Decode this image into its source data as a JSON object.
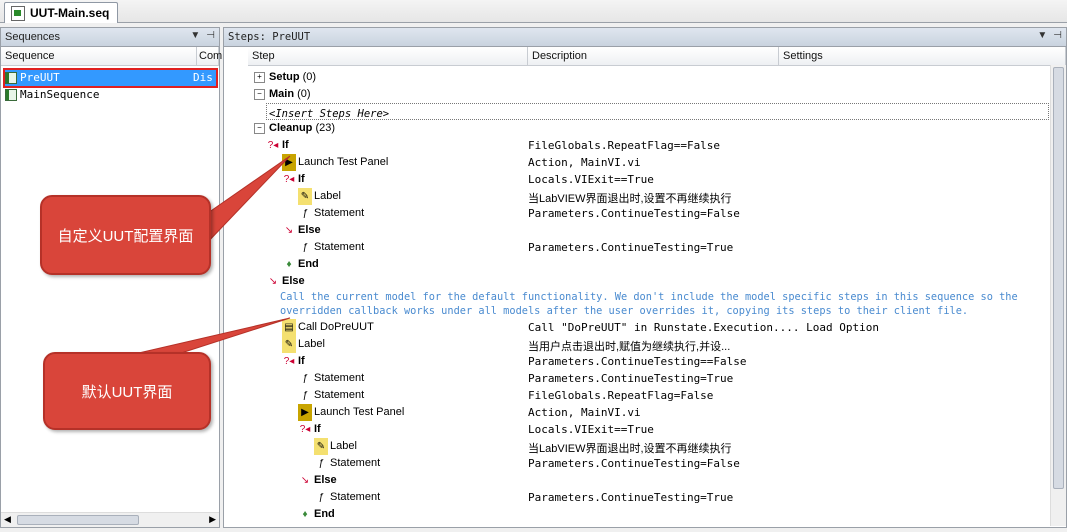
{
  "tab": {
    "title": "UUT-Main.seq"
  },
  "sequences_pane": {
    "title": "Sequences",
    "columns": [
      "Sequence",
      "Com"
    ],
    "rows": [
      {
        "name": "PreUUT",
        "comment": "Dis"
      },
      {
        "name": "MainSequence",
        "comment": ""
      }
    ]
  },
  "steps_pane": {
    "title": "Steps: PreUUT",
    "columns": [
      "Step",
      "Description",
      "Settings"
    ],
    "groups": {
      "setup": {
        "name": "Setup",
        "count": "(0)"
      },
      "main": {
        "name": "Main",
        "count": "(0)",
        "placeholder": "<Insert Steps Here>"
      },
      "cleanup": {
        "name": "Cleanup",
        "count": "(23)"
      }
    },
    "steps": [
      {
        "name": "If",
        "desc": "FileGlobals.RepeatFlag==False"
      },
      {
        "name": "Launch Test Panel",
        "desc": "Action,   MainVI.vi"
      },
      {
        "name": "If",
        "desc": "Locals.VIExit==True"
      },
      {
        "name": "Label",
        "desc": "当LabVIEW界面退出时,设置不再继续执行"
      },
      {
        "name": "Statement",
        "desc": "Parameters.ContinueTesting=False"
      },
      {
        "name": "Else",
        "desc": ""
      },
      {
        "name": "Statement",
        "desc": "Parameters.ContinueTesting=True"
      },
      {
        "name": "End",
        "desc": ""
      },
      {
        "name": "Else",
        "desc": ""
      },
      {
        "name": "Call DoPreUUT",
        "desc": "Call \"DoPreUUT\" in Runstate.Execution.... Load Option"
      },
      {
        "name": "Label",
        "desc": "当用户点击退出时,赋值为继续执行,并设..."
      },
      {
        "name": "If",
        "desc": "Parameters.ContinueTesting==False"
      },
      {
        "name": "Statement",
        "desc": "Parameters.ContinueTesting=True"
      },
      {
        "name": "Statement",
        "desc": "FileGlobals.RepeatFlag=False"
      },
      {
        "name": "Launch Test Panel",
        "desc": "Action,   MainVI.vi"
      },
      {
        "name": "If",
        "desc": "Locals.VIExit==True"
      },
      {
        "name": "Label",
        "desc": "当LabVIEW界面退出时,设置不再继续执行"
      },
      {
        "name": "Statement",
        "desc": "Parameters.ContinueTesting=False"
      },
      {
        "name": "Else",
        "desc": ""
      },
      {
        "name": "Statement",
        "desc": "Parameters.ContinueTesting=True"
      },
      {
        "name": "End",
        "desc": ""
      }
    ],
    "comment_line1": "Call the current model for the default functionality. We don't include the model specific steps in this sequence so the",
    "comment_line2": "overridden callback works under all models after the user overrides it, copying its steps to their client file."
  },
  "callouts": [
    {
      "text": "自定义UUT配置界面"
    },
    {
      "text": "默认UUT界面"
    }
  ],
  "icons": {
    "pin": "pin-icon",
    "dropdown": "dropdown-icon"
  },
  "colors": {
    "selection": "#3399ff",
    "callout": "#d9453a",
    "highlight_border": "#e02020",
    "comment": "#4a8bd0"
  }
}
